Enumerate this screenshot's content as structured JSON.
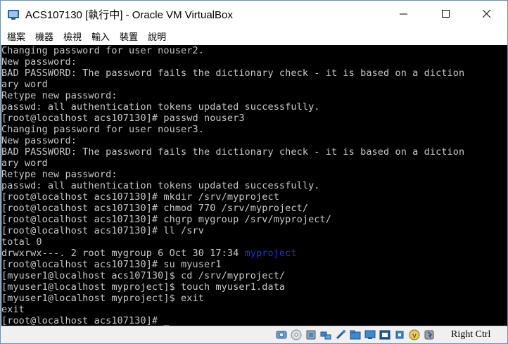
{
  "window": {
    "title": "ACS107130 [執行中] - Oracle VM VirtualBox"
  },
  "menu": [
    {
      "label": "檔案"
    },
    {
      "label": "機器"
    },
    {
      "label": "檢視"
    },
    {
      "label": "輸入"
    },
    {
      "label": "裝置"
    },
    {
      "label": "說明"
    }
  ],
  "terminal": {
    "lines": [
      "Changing password for user nouser2.",
      "New password:",
      "BAD PASSWORD: The password fails the dictionary check - it is based on a diction",
      "ary word",
      "Retype new password:",
      "passwd: all authentication tokens updated successfully.",
      "[root@localhost acs107130]# passwd nouser3",
      "Changing password for user nouser3.",
      "New password:",
      "BAD PASSWORD: The password fails the dictionary check - it is based on a diction",
      "ary word",
      "Retype new password:",
      "passwd: all authentication tokens updated successfully.",
      "[root@localhost acs107130]# mkdir /srv/myproject",
      "[root@localhost acs107130]# chmod 770 /srv/myproject/",
      "[root@localhost acs107130]# chgrp mygroup /srv/myproject/",
      "[root@localhost acs107130]# ll /srv",
      "total 0"
    ],
    "ls_line": {
      "prefix": "drwxrwx---. 2 root mygroup 6 Oct 30 17:34 ",
      "dirname": "myproject"
    },
    "lines_after": [
      "[root@localhost acs107130]# su myuser1",
      "[myuser1@localhost acs107130]$ cd /srv/myproject/",
      "[myuser1@localhost myproject]$ touch myuser1.data",
      "[myuser1@localhost myproject]$ exit",
      "exit"
    ],
    "prompt_line": "[root@localhost acs107130]# ",
    "cursor": "_"
  },
  "status": {
    "host_key": "Right Ctrl",
    "icons": [
      "hard-disk-icon",
      "optical-drive-icon",
      "audio-icon",
      "network-icon",
      "usb-icon",
      "shared-folders-icon",
      "display-icon",
      "video-capture-icon",
      "cpu-icon",
      "virtualization-icon",
      "mouse-integration-icon"
    ]
  },
  "colors": {
    "terminal_bg": "#000000",
    "terminal_fg": "#c8c8c8",
    "dir_highlight": "#2230d8"
  }
}
